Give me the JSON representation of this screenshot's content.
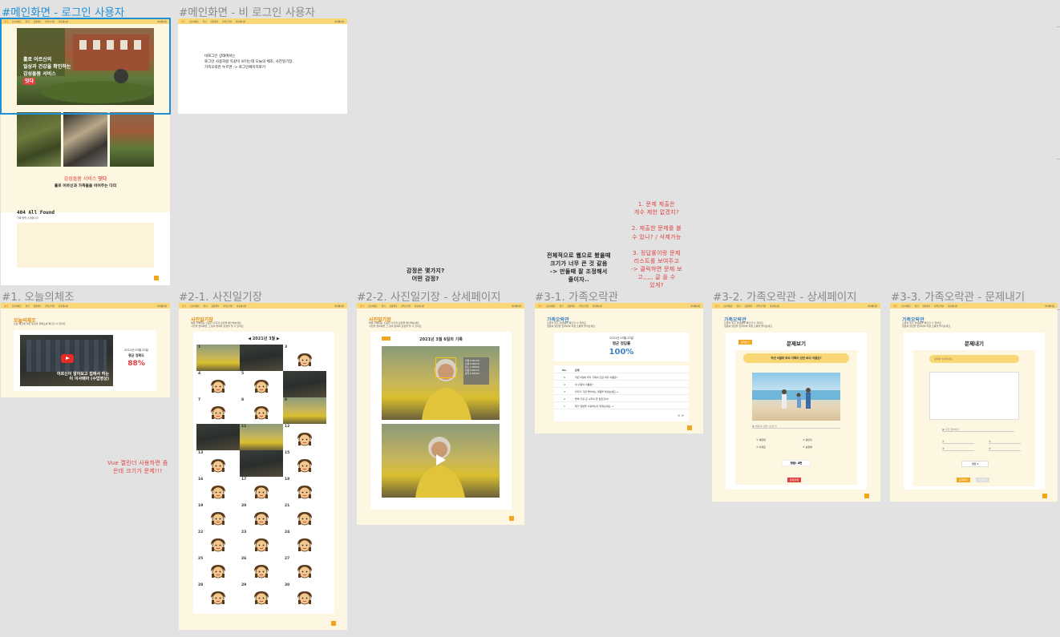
{
  "frames": {
    "main_login": {
      "title": "#메인화면 - 로그인 사용자"
    },
    "main_guest": {
      "title": "#메인화면 - 비 로그인 사용자"
    },
    "exercise": {
      "title": "#1. 오늘의체조"
    },
    "photo_diary": {
      "title": "#2-1. 사진일기장"
    },
    "photo_detail": {
      "title": "#2-2. 사진일기장 - 상세페이지"
    },
    "quiz_hall": {
      "title": "#3-1. 가족오락관"
    },
    "quiz_detail": {
      "title": "#3-2. 가족오락관 - 상세페이지"
    },
    "quiz_create": {
      "title": "#3-3. 가족오락관 - 문제내기"
    }
  },
  "nav": {
    "logo": "잇다",
    "items": [
      "오늘의체조",
      "일기",
      "감정레터",
      "가족오락관",
      "자랑게시판"
    ],
    "right": "마이페이지"
  },
  "main_login": {
    "hero_lines": [
      "홀로 어르신의",
      "일상과 건강을 확인하는",
      "감성돌봄 서비스",
      "잇다"
    ],
    "service_red": "감성돌봄 서비스",
    "service_brand": "잇다",
    "service_sub": "홀로 어르신과 가족들을 이어주는 다리",
    "notfound_title": "404 All Found",
    "notfound_sub": "가족 방을 소개합니다"
  },
  "main_guest": {
    "text": [
      "비로그인 상태에서는",
      "로그인 사용자랑 똑같이 보이는데 오늘의 체조, 사진일기장,",
      "가족오락관 누르면 -> 로그인페이지로??"
    ]
  },
  "exercise": {
    "heading": "오늘의체조",
    "sub": "오늘 체조에 대한 영상과 정확도를 확인할 수 있어요",
    "video_caption": "어르신이 알아보고 집에서 하는\n이 이사배아 (수업영상)",
    "date": "2021년 03월 23일",
    "accuracy_label": "평균 정확도",
    "accuracy": "88%"
  },
  "photo_diary": {
    "heading": "사진일기장",
    "sub": "매일 기록되는 소중한 사진과 감정을 확인해보세요\n사진을 클릭하면 그 날의 변화와 감정을 볼 수 있어요",
    "month": "◀  2021년  3월  ▶",
    "days": [
      "1",
      "2",
      "3",
      "4",
      "5",
      "6",
      "7",
      "8",
      "9",
      "10",
      "11",
      "12",
      "13",
      "14",
      "15",
      "16",
      "17",
      "18",
      "19",
      "20",
      "21",
      "22",
      "23",
      "24",
      "25",
      "26",
      "27",
      "28",
      "29",
      "30"
    ]
  },
  "photo_detail": {
    "heading": "사진일기장",
    "sub": "매일 기록되는 소중한 사진과 감정을 확인해보세요\n사진을 클릭하면 그 날의 변화와 감정을 볼 수 있어요",
    "date": "2021년  3월  6일의 기록",
    "emotions": [
      "행복 0.95126",
      "슬픔 0.00078",
      "분노 0.00056",
      "놀람 0.00142",
      "중립 0.04524"
    ]
  },
  "quiz_hall": {
    "heading": "가족오락관",
    "sub": "오늘의 퀴즈 정답률을 확인할 수 있어요\n질문에 정답을 입력하여 직접 소통을 즐겨보세요",
    "date": "2021년 03월 23일",
    "avg_label": "평균 정답률",
    "avg": "100%",
    "col_no": "No.",
    "col_q": "문제",
    "questions": [
      {
        "no": "5",
        "q": "작년 9월에 우리 가족이 갔던 바다 이름은?"
      },
      {
        "no": "4",
        "q": "이 사람의 이름은?"
      },
      {
        "no": "3",
        "q": "우리가 가장 좋아하는 계절을 맞춰보세요~!"
      },
      {
        "no": "2",
        "q": "올해 가장 큰 나무의 꽃 달은것이?"
      },
      {
        "no": "1",
        "q": "제가 일본을 사랑하는지 맞춰보세요~♪"
      }
    ],
    "pager": "< >"
  },
  "quiz_detail": {
    "heading": "가족오락관",
    "sub": "오늘의 퀴즈 정답률을 확인할 수 있어요\n질문에 정답을 입력하여 직접 소통을 즐겨보세요",
    "badge": "문제보기",
    "title": "문제보기",
    "question": "작년 9월에 우리 가족이 갔던 바다 이름은?",
    "hint": "해운대, 광안 (오답가)",
    "options": [
      "① 해운대",
      "② 광안리",
      "③ 다대포",
      "④ 송정해"
    ],
    "answer": "정답: 4번",
    "delete": "문제삭제"
  },
  "quiz_create": {
    "heading": "가족오락관",
    "sub": "오늘의 퀴즈 정답률을 확인할 수 있어요\n질문에 정답을 입력하여 직접 소통을 즐겨보세요",
    "title": "문제내기",
    "placeholder": "문제를 입력하세요",
    "photo_label": "사진 첨부하기",
    "option_marks": [
      "①",
      "③",
      "②",
      "④"
    ],
    "answer_select": "정답",
    "submit": "문제제출",
    "cancel": "취소하기"
  },
  "notes": {
    "vue_calendar": "Vue 캘린더 사용하면 좀\n은데 크기가 문제!!!",
    "emotion": "감정은 몇가지?\n어떤 감정?",
    "table_size": "전체적으로 웹으로 봤을때\n크기가 너무 큰 것 같음\n-> 만들때 잘 조정해서\n줄이자..",
    "questions": "1. 문제 제출은\n개수 제한 없겠지?\n\n2. 제출한 문제를 볼\n수 있나? / 삭제가능\n\n3. 정답률이랑 문제\n리스트를 보여주고\n-> 클릭하면 문제 보\n고,,,,, 글 쓸 수\n있게?"
  }
}
